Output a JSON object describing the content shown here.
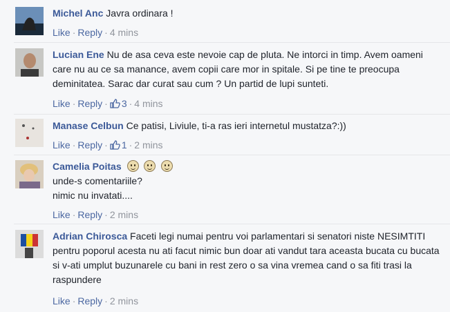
{
  "actions": {
    "like": "Like",
    "reply": "Reply",
    "sep": "·"
  },
  "comments": [
    {
      "author": "Michel Anc",
      "text": "Javra ordinara !",
      "likes": "",
      "time": "4 mins"
    },
    {
      "author": "Lucian Ene",
      "text": "Nu de asa ceva este nevoie cap de pluta. Ne intorci in timp. Avem oameni care nu au ce sa manance, avem copii care mor in spitale. Si pe tine te preocupa deminitatea. Sarac dar curat sau cum ? Un partid de lupi sunteti.",
      "likes": "3",
      "time": "4 mins"
    },
    {
      "author": "Manase Celbun",
      "text": "Ce patisi, Liviule, ti-a ras ieri internetul mustatza?:))",
      "likes": "1",
      "time": "2 mins"
    },
    {
      "author": "Camelia Poitas",
      "line1": "unde-s comentariile?",
      "line2": "nimic nu invatati....",
      "likes": "",
      "time": "2 mins",
      "emoji": "smile-emoji"
    },
    {
      "author": "Adrian Chirosca",
      "text": "Faceti legi numai pentru voi parlamentari si senatori niste NESIMTITI pentru poporul acesta nu ati facut nimic bun doar ati vandut tara aceasta bucata cu bucata si v-ati umplut buzunarele cu bani in rest zero o sa vina vremea cand o sa fiti trasi la raspundere",
      "likes": "",
      "time": "2 mins"
    }
  ],
  "colors": {
    "author": "#3b5998",
    "link": "#4b67a1",
    "meta": "#90949c",
    "background": "#f6f7f9"
  }
}
